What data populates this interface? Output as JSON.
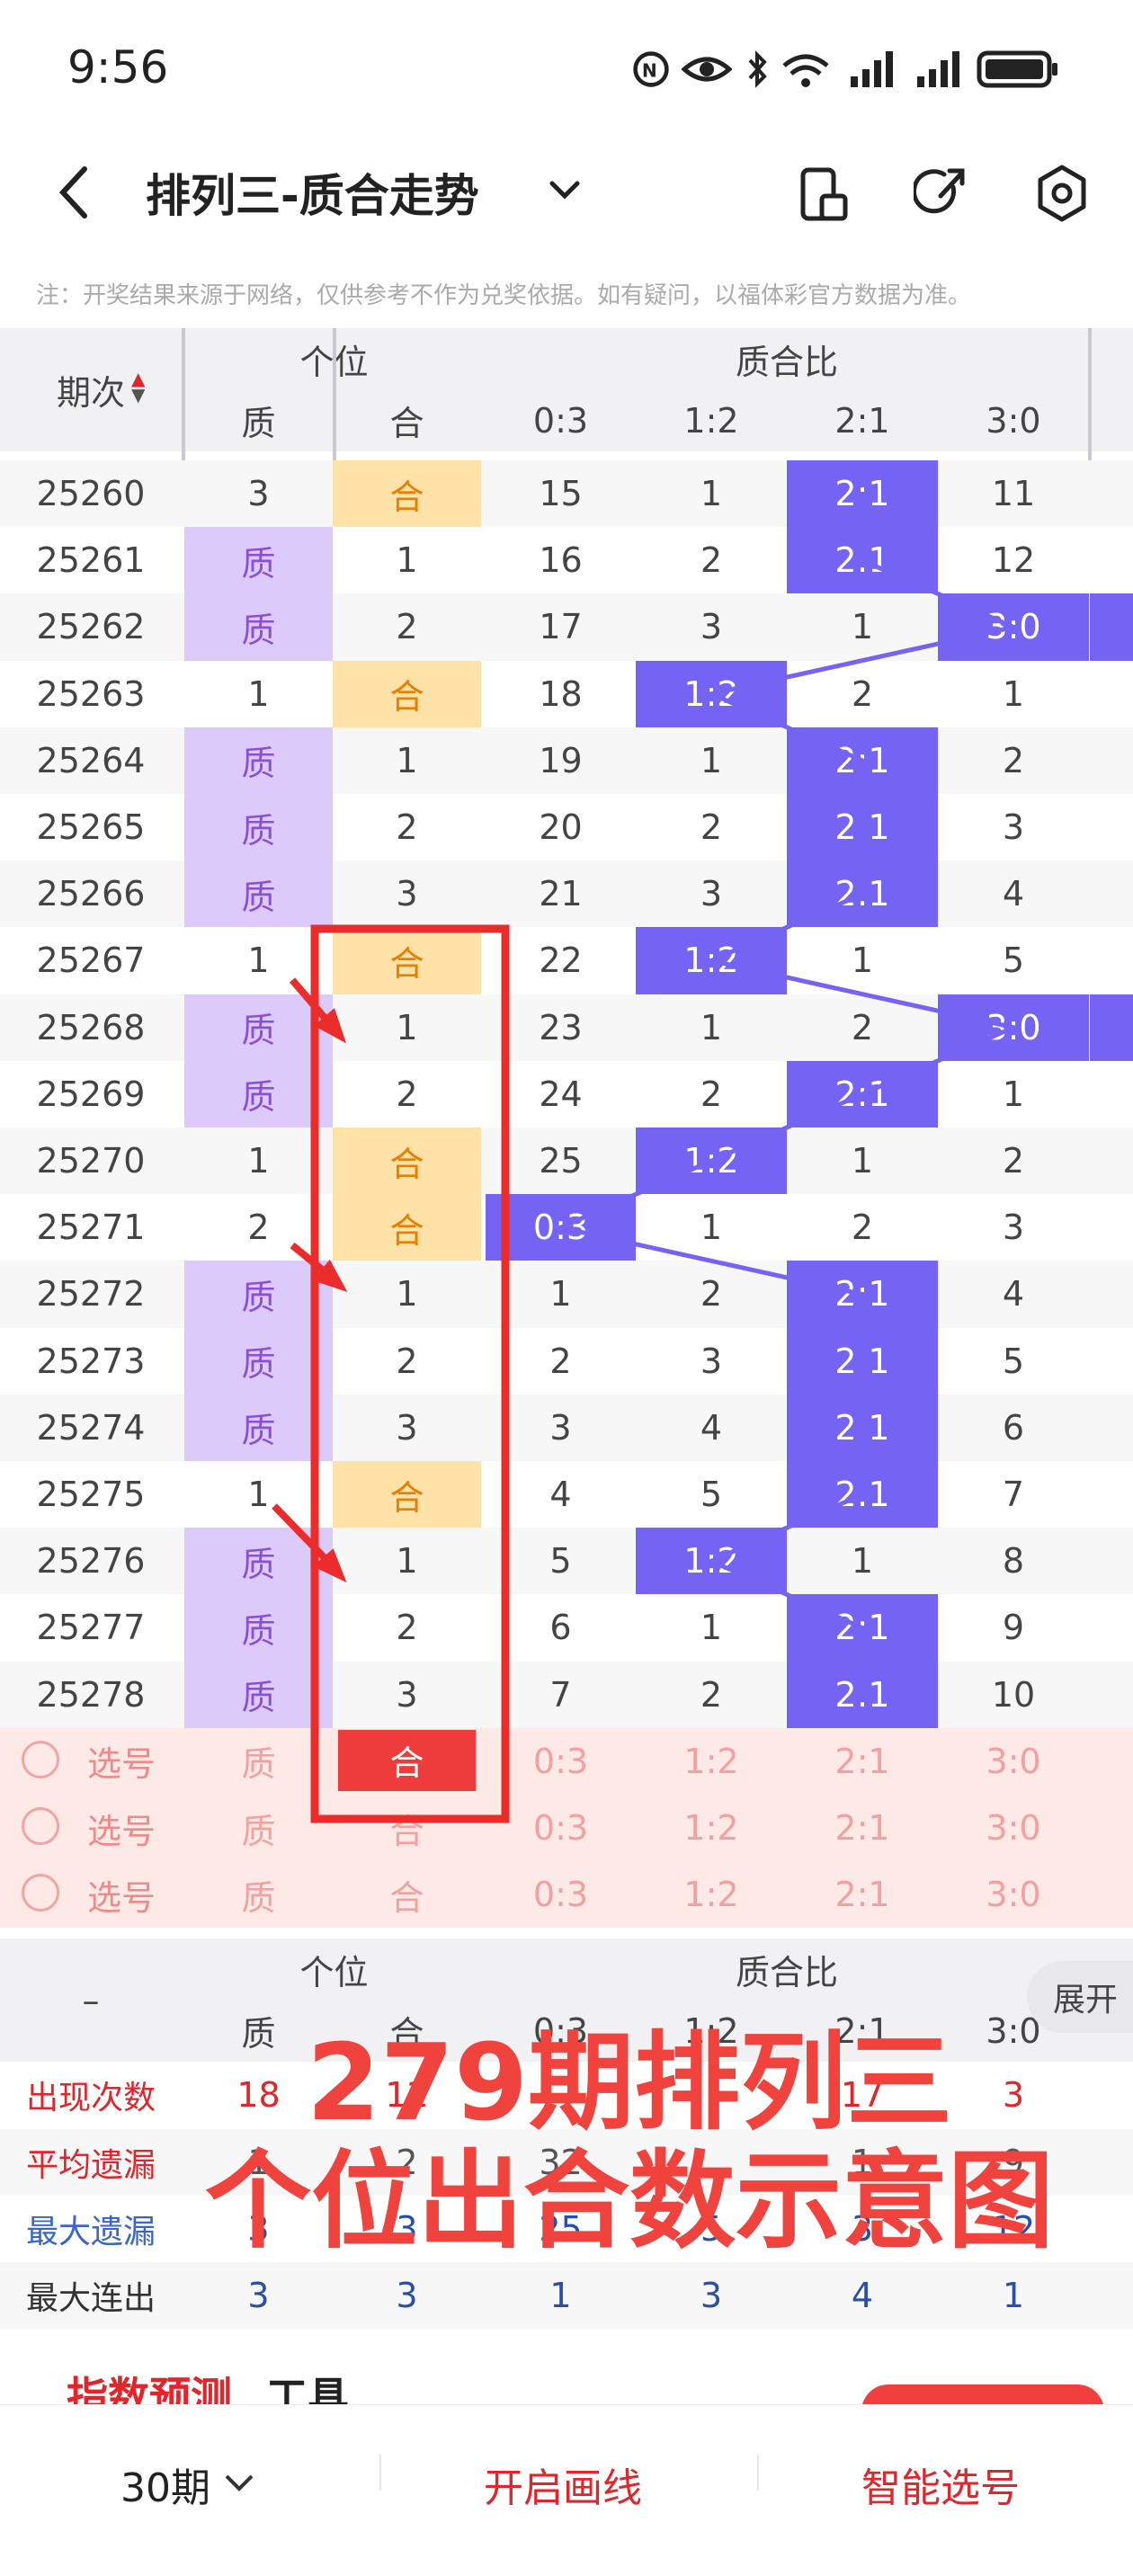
{
  "status": {
    "time": "9:56"
  },
  "appbar": {
    "title": "排列三-质合走势"
  },
  "note": "注：开奖结果来源于网络，仅供参考不作为兑奖依据。如有疑问，以福体彩官方数据为准。",
  "table": {
    "period_header": "期次",
    "group1": "个位",
    "group2": "质合比",
    "cols": [
      "质",
      "合",
      "0:3",
      "1:2",
      "2:1",
      "3:0"
    ],
    "rows": [
      {
        "p": "25260",
        "z": "3",
        "h": "合",
        "c0": "15",
        "c1": "1",
        "c2": "2:1",
        "c3": "11",
        "zh": false,
        "hh": true,
        "hi": 2
      },
      {
        "p": "25261",
        "z": "质",
        "h": "1",
        "c0": "16",
        "c1": "2",
        "c2": "2:1",
        "c3": "12",
        "zh": true,
        "hh": false,
        "hi": 2
      },
      {
        "p": "25262",
        "z": "质",
        "h": "2",
        "c0": "17",
        "c1": "3",
        "c2": "1",
        "c3": "3:0",
        "zh": true,
        "hh": false,
        "hi": 3
      },
      {
        "p": "25263",
        "z": "1",
        "h": "合",
        "c0": "18",
        "c1": "1:2",
        "c2": "2",
        "c3": "1",
        "zh": false,
        "hh": true,
        "hi": 1
      },
      {
        "p": "25264",
        "z": "质",
        "h": "1",
        "c0": "19",
        "c1": "1",
        "c2": "2:1",
        "c3": "2",
        "zh": true,
        "hh": false,
        "hi": 2
      },
      {
        "p": "25265",
        "z": "质",
        "h": "2",
        "c0": "20",
        "c1": "2",
        "c2": "2:1",
        "c3": "3",
        "zh": true,
        "hh": false,
        "hi": 2
      },
      {
        "p": "25266",
        "z": "质",
        "h": "3",
        "c0": "21",
        "c1": "3",
        "c2": "2:1",
        "c3": "4",
        "zh": true,
        "hh": false,
        "hi": 2
      },
      {
        "p": "25267",
        "z": "1",
        "h": "合",
        "c0": "22",
        "c1": "1:2",
        "c2": "1",
        "c3": "5",
        "zh": false,
        "hh": true,
        "hi": 1
      },
      {
        "p": "25268",
        "z": "质",
        "h": "1",
        "c0": "23",
        "c1": "1",
        "c2": "2",
        "c3": "3:0",
        "zh": true,
        "hh": false,
        "hi": 3
      },
      {
        "p": "25269",
        "z": "质",
        "h": "2",
        "c0": "24",
        "c1": "2",
        "c2": "2:1",
        "c3": "1",
        "zh": true,
        "hh": false,
        "hi": 2
      },
      {
        "p": "25270",
        "z": "1",
        "h": "合",
        "c0": "25",
        "c1": "1:2",
        "c2": "1",
        "c3": "2",
        "zh": false,
        "hh": true,
        "hi": 1
      },
      {
        "p": "25271",
        "z": "2",
        "h": "合",
        "c0": "0:3",
        "c1": "1",
        "c2": "2",
        "c3": "3",
        "zh": false,
        "hh": true,
        "hi": 0
      },
      {
        "p": "25272",
        "z": "质",
        "h": "1",
        "c0": "1",
        "c1": "2",
        "c2": "2:1",
        "c3": "4",
        "zh": true,
        "hh": false,
        "hi": 2
      },
      {
        "p": "25273",
        "z": "质",
        "h": "2",
        "c0": "2",
        "c1": "3",
        "c2": "2:1",
        "c3": "5",
        "zh": true,
        "hh": false,
        "hi": 2
      },
      {
        "p": "25274",
        "z": "质",
        "h": "3",
        "c0": "3",
        "c1": "4",
        "c2": "2:1",
        "c3": "6",
        "zh": true,
        "hh": false,
        "hi": 2
      },
      {
        "p": "25275",
        "z": "1",
        "h": "合",
        "c0": "4",
        "c1": "5",
        "c2": "2:1",
        "c3": "7",
        "zh": false,
        "hh": true,
        "hi": 2
      },
      {
        "p": "25276",
        "z": "质",
        "h": "1",
        "c0": "5",
        "c1": "1:2",
        "c2": "1",
        "c3": "8",
        "zh": true,
        "hh": false,
        "hi": 1
      },
      {
        "p": "25277",
        "z": "质",
        "h": "2",
        "c0": "6",
        "c1": "1",
        "c2": "2:1",
        "c3": "9",
        "zh": true,
        "hh": false,
        "hi": 2
      },
      {
        "p": "25278",
        "z": "质",
        "h": "3",
        "c0": "7",
        "c1": "2",
        "c2": "2:1",
        "c3": "10",
        "zh": true,
        "hh": false,
        "hi": 2
      }
    ],
    "select_label": "选号",
    "select_rows": 3,
    "summary": {
      "dash": "–",
      "expand": "展开",
      "labels": [
        "出现次数",
        "平均遗漏",
        "最大遗漏",
        "最大连出"
      ],
      "label_colors": [
        "#e0262b",
        "#e0262b",
        "#3a66c8",
        "#333"
      ],
      "values": [
        [
          "18",
          "12",
          "",
          "",
          "17",
          "3"
        ],
        [
          "1",
          "2",
          "32",
          "",
          "1",
          "9"
        ],
        [
          "3",
          "3",
          "25",
          "5",
          "3",
          "12"
        ],
        [
          "3",
          "3",
          "1",
          "3",
          "4",
          "1"
        ]
      ]
    }
  },
  "annotation": {
    "line1": "279期排列三",
    "line2": "个位出合数示意图"
  },
  "card": {
    "title_red": "指数预测",
    "title_black": "工具"
  },
  "bottom": {
    "periods": "30期",
    "draw": "开启画线",
    "smart": "智能选号"
  }
}
